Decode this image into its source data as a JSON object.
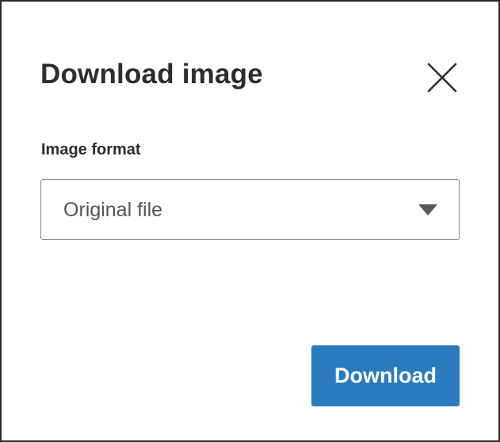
{
  "dialog": {
    "title": "Download image",
    "close_icon": "close-icon"
  },
  "format_field": {
    "label": "Image format",
    "selected_value": "Original file",
    "dropdown_icon": "caret-down-icon"
  },
  "actions": {
    "download_label": "Download"
  },
  "colors": {
    "primary_button": "#2a7bbd",
    "title_text": "#2d2d2d",
    "select_text": "#555555",
    "select_border": "#8a8a8a",
    "dialog_border": "#2b2b2b"
  }
}
